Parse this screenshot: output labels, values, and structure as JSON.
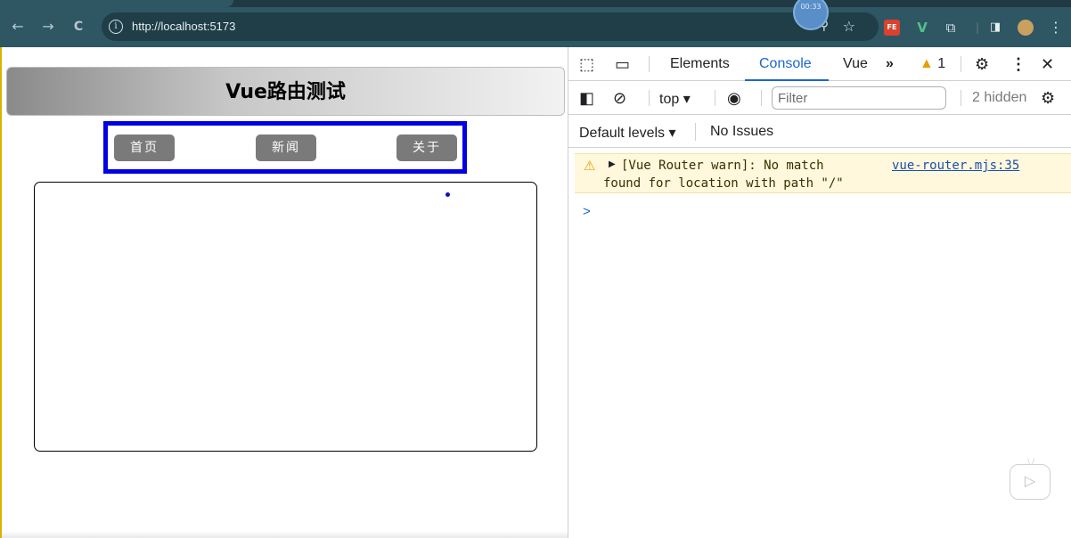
{
  "browser": {
    "url": "http://localhost:5173",
    "timer": "00:33",
    "nav": {
      "back": "←",
      "forward": "→",
      "reload": "C"
    },
    "extensions": [
      "fe-helper-icon",
      "vue-devtools-icon",
      "extensions-puzzle-icon",
      "side-panel-icon",
      "profile-avatar",
      "menu-dots-icon"
    ]
  },
  "page": {
    "title": "Vue路由测试",
    "nav_buttons": [
      "首页",
      "新闻",
      "关于"
    ]
  },
  "devtools": {
    "tabs": [
      "Elements",
      "Console",
      "Vue"
    ],
    "active_tab": "Console",
    "more_tabs": "»",
    "warning_count": "1",
    "context": "top",
    "filter_placeholder": "Filter",
    "hidden": "2 hidden",
    "levels": "Default levels",
    "issues": "No Issues",
    "messages": [
      {
        "level": "warning",
        "line1": "[Vue Router warn]: No match",
        "line2": "found for location with path \"/\"",
        "source": "vue-router.mjs:35"
      }
    ],
    "prompt": ">"
  },
  "colors": {
    "accent": "#1a66d1",
    "nav_border": "#0000e0",
    "warning_bg": "#fff8dc",
    "warning_icon": "#e5a000",
    "browser_toolbar": "#2f5663"
  }
}
